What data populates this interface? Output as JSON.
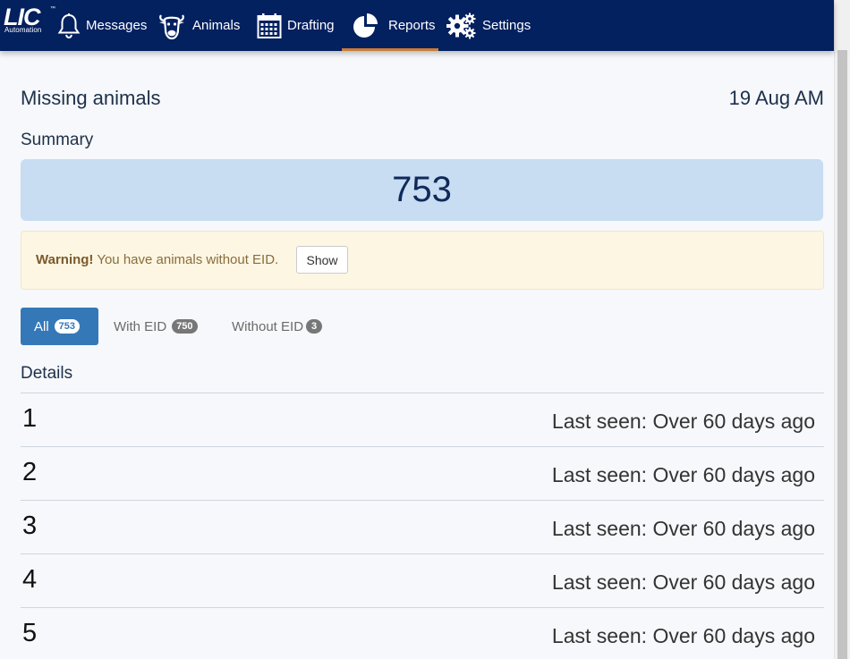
{
  "brand": {
    "name": "LIC",
    "trademark": "™",
    "subtitle": "Automation"
  },
  "nav": {
    "items": [
      {
        "label": "Messages",
        "icon": "bell-icon"
      },
      {
        "label": "Animals",
        "icon": "cow-icon"
      },
      {
        "label": "Drafting",
        "icon": "calendar-icon"
      },
      {
        "label": "Reports",
        "icon": "pie-chart-icon",
        "active": true
      },
      {
        "label": "Settings",
        "icon": "gears-icon"
      }
    ]
  },
  "colors": {
    "navbar": "#03205f",
    "active_indicator": "#c97d3a",
    "summary_bg": "#c8dcf2",
    "warning_bg": "#fcf6e3",
    "tab_active": "#3578b8"
  },
  "page": {
    "title": "Missing animals",
    "date": "19 Aug AM"
  },
  "summary": {
    "label": "Summary",
    "value": "753"
  },
  "warning": {
    "strong": "Warning!",
    "text": " You have animals without EID.",
    "button": "Show"
  },
  "tabs": [
    {
      "label": "All",
      "count": "753",
      "active": true
    },
    {
      "label": "With EID",
      "count": "750"
    },
    {
      "label": "Without EID",
      "count": "3"
    }
  ],
  "details": {
    "label": "Details",
    "rows": [
      {
        "id": "1",
        "seen": "Last seen: Over 60 days ago"
      },
      {
        "id": "2",
        "seen": "Last seen: Over 60 days ago"
      },
      {
        "id": "3",
        "seen": "Last seen: Over 60 days ago"
      },
      {
        "id": "4",
        "seen": "Last seen: Over 60 days ago"
      },
      {
        "id": "5",
        "seen": "Last seen: Over 60 days ago"
      }
    ]
  }
}
